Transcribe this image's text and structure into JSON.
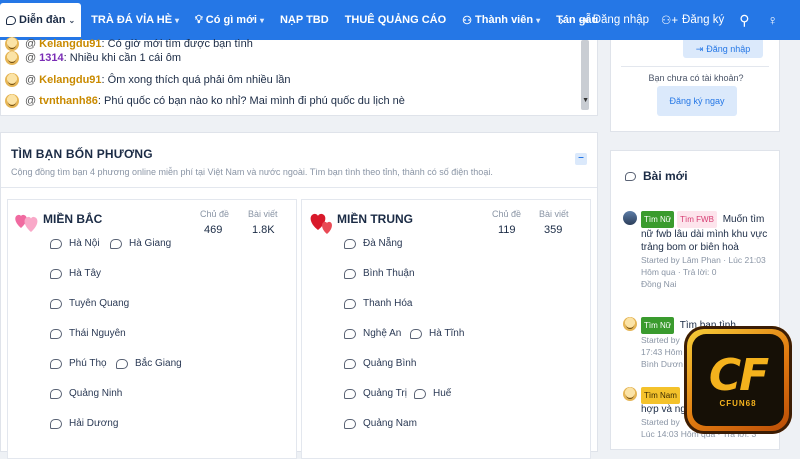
{
  "navbar": {
    "items": [
      {
        "label": "Diễn đàn",
        "caret": true,
        "active": true
      },
      {
        "label": "TRÀ ĐÁ VỈA HÈ",
        "caret": true
      },
      {
        "label": "Có gì mới",
        "caret": true
      },
      {
        "label": "NẠP TBD"
      },
      {
        "label": "THUÊ QUẢNG CÁO"
      },
      {
        "label": "Thành viên",
        "caret": true
      },
      {
        "label": "Tán gẫu"
      }
    ],
    "more_icon": "chevron-right-icon",
    "login_label": "Đăng nhập",
    "register_label": "Đăng ký",
    "search_icon": "search-icon",
    "idea_icon": "lightbulb-icon"
  },
  "chat": {
    "messages": [
      {
        "user": "Kelangdu91",
        "text": "Có giờ mới tìm được bạn tình",
        "color": "#c98a00"
      },
      {
        "user": "1314",
        "text": "Nhiều khi cần 1 cái ôm",
        "color": "#7a2cb5"
      },
      {
        "user": "Kelangdu91",
        "text": "Ôm xong thích quá phải ôm nhiều lần",
        "color": "#c98a00"
      },
      {
        "user": "tvnthanh86",
        "text": "Phú quốc có bạn nào ko nhỉ? Mai mình đi phú quốc du lịch nè",
        "color": "#c98a00"
      }
    ]
  },
  "section": {
    "title": "TÌM BẠN BỐN PHƯƠNG",
    "description": "Cộng đồng tìm bạn 4 phương online miễn phí tại Việt Nam và nước ngoài. Tìm bạn tình theo tỉnh, thành có số điện thoại.",
    "regions": [
      {
        "title": "MIỀN BẮC",
        "threads_label": "Chủ đề",
        "threads": "469",
        "posts_label": "Bài viết",
        "posts": "1.8K",
        "forums": [
          "Hà Nội",
          "Hà Giang",
          "Hà Tây",
          "Tuyên Quang",
          "Thái Nguyên",
          "Phú Thọ",
          "Bắc Giang",
          "Quảng Ninh",
          "Hải Dương"
        ]
      },
      {
        "title": "MIỀN TRUNG",
        "threads_label": "Chủ đề",
        "threads": "119",
        "posts_label": "Bài viết",
        "posts": "359",
        "forums": [
          "Đà Nẵng",
          "Bình Thuận",
          "Thanh Hóa",
          "Nghệ An",
          "Hà Tĩnh",
          "Quảng Bình",
          "Quảng Trị",
          "Huế",
          "Quảng Nam"
        ]
      }
    ]
  },
  "sidebar": {
    "login_button": "Đăng nhập",
    "no_account": "Bạn chưa có tài khoản?",
    "register_button": "Đăng ký ngay",
    "new_posts_title": "Bài mới",
    "posts": [
      {
        "tags": [
          {
            "label": "Tìm Nữ",
            "style": "green"
          },
          {
            "label": "Tìm FWB",
            "style": "pink"
          }
        ],
        "title": "Muốn tìm nữ fwb lâu dài mình khu vực trảng bom or biên hoà",
        "meta": [
          "Started by Lâm Phan · Lúc 21:03",
          "Hôm qua · Trả lời: 0",
          "Đồng Nai"
        ]
      },
      {
        "tags": [
          {
            "label": "Tìm Nữ",
            "style": "green"
          }
        ],
        "title": "Tìm bạn tình",
        "meta": [
          "Started by",
          "17:43 Hôm",
          "Bình Dươn"
        ]
      },
      {
        "tags": [
          {
            "label": "Tìm Nam",
            "style": "yellow"
          }
        ],
        "title": "",
        "meta": [
          "hợp và ng",
          "Started by",
          "Lúc 14:03 Hôm qua · Trả lời: 3"
        ]
      }
    ]
  },
  "logo": {
    "text": "CF",
    "subtext": "CFUN68"
  }
}
